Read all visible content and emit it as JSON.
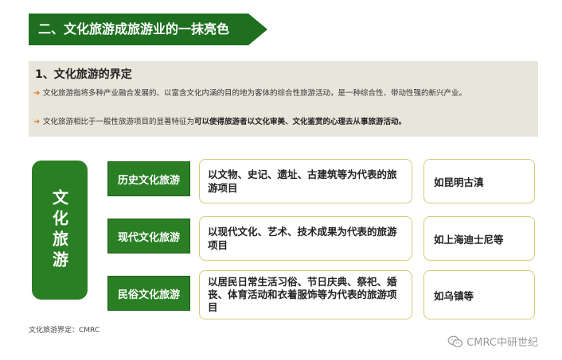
{
  "header": {
    "title": "二、文化旅游成旅游业的一抹亮色",
    "color": "#1e6f1f"
  },
  "definition": {
    "title": "1、文化旅游的界定",
    "bullets": [
      {
        "text": "文化旅游指将多种产业融合发展的、以富含文化内涵的目的地为客体的综合性旅游活动，是一种综合性、带动性强的新兴产业。",
        "bold": ""
      },
      {
        "text": "文化旅游相比于一般性旅游项目的显著特征为",
        "bold": "可以使得旅游者以文化审美、文化鉴赏的心理去从事旅游活动。"
      }
    ],
    "background": "#e8e5da"
  },
  "diagram": {
    "main_label": "文化旅游",
    "categories": [
      {
        "name": "历史文化旅游",
        "description": "以文物、史记、遗址、古建筑等为代表的旅游项目",
        "example": "如昆明古滇"
      },
      {
        "name": "现代文化旅游",
        "description": "以现代文化、艺术、技术成果为代表的旅游项目",
        "example": "如上海迪士尼等"
      },
      {
        "name": "民俗文化旅游",
        "description": "以居民日常生活习俗、节日庆典、祭祀、婚丧、体育活动和衣着服饰等为代表的旅游项目",
        "example": "如乌镇等"
      }
    ],
    "green": "#2a7f24",
    "border": "#d8c878"
  },
  "source": "文化旅游界定：CMRC",
  "watermark": {
    "text": "CMRC中研世纪",
    "icon": "wechat-icon"
  }
}
